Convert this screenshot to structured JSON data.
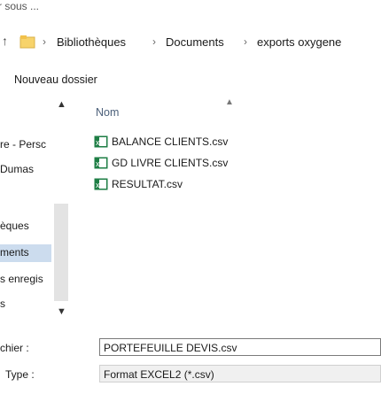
{
  "window": {
    "title": "r sous ..."
  },
  "address": {
    "segments": [
      "Bibliothèques",
      "Documents",
      "exports oxygene"
    ]
  },
  "toolbar": {
    "new_folder": "Nouveau dossier"
  },
  "nav": {
    "items": [
      "re - Persc",
      "Dumas",
      "èques",
      "ments",
      "s enregis",
      "s"
    ]
  },
  "list": {
    "column_name": "Nom",
    "files": [
      "BALANCE CLIENTS.csv",
      "GD LIVRE CLIENTS.csv",
      "RESULTAT.csv"
    ]
  },
  "form": {
    "filename_label": "chier :",
    "filename_value": "PORTEFEUILLE DEVIS.csv",
    "type_label": "Type :",
    "type_value": "Format EXCEL2 (*.csv)"
  }
}
